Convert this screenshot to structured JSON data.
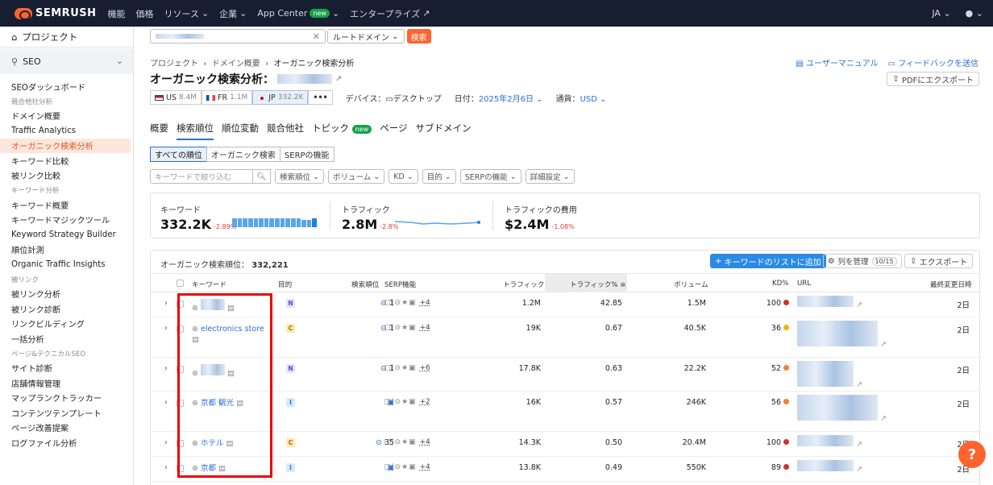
{
  "topbar": {
    "brand": "SEMRUSH",
    "nav": [
      "機能",
      "価格",
      "リソース",
      "企業",
      "App Center",
      "エンタープライズ"
    ],
    "app_center_badge": "new",
    "lang": "JA"
  },
  "sidebar": {
    "project": "プロジェクト",
    "seo": "SEO",
    "items": [
      {
        "type": "item",
        "label": "SEOダッシュボード"
      },
      {
        "type": "cat",
        "label": "競合他社分析"
      },
      {
        "type": "item",
        "label": "ドメイン概要"
      },
      {
        "type": "item",
        "label": "Traffic Analytics"
      },
      {
        "type": "active",
        "label": "オーガニック検索分析"
      },
      {
        "type": "item",
        "label": "キーワード比較"
      },
      {
        "type": "item",
        "label": "被リンク比較"
      },
      {
        "type": "cat",
        "label": "キーワード分析"
      },
      {
        "type": "item",
        "label": "キーワード概要"
      },
      {
        "type": "item",
        "label": "キーワードマジックツール"
      },
      {
        "type": "item",
        "label": "Keyword Strategy Builder"
      },
      {
        "type": "item",
        "label": "順位計測"
      },
      {
        "type": "item",
        "label": "Organic Traffic Insights"
      },
      {
        "type": "cat",
        "label": "被リンク"
      },
      {
        "type": "item",
        "label": "被リンク分析"
      },
      {
        "type": "item",
        "label": "被リンク診断"
      },
      {
        "type": "item",
        "label": "リンクビルディング"
      },
      {
        "type": "item",
        "label": "一括分析"
      },
      {
        "type": "cat",
        "label": "ページ&テクニカルSEO"
      },
      {
        "type": "item",
        "label": "サイト診断"
      },
      {
        "type": "item",
        "label": "店舗情報管理"
      },
      {
        "type": "item",
        "label": "マップランクトラッカー"
      },
      {
        "type": "item",
        "label": "コンテンツテンプレート"
      },
      {
        "type": "item",
        "label": "ページ改善提案"
      },
      {
        "type": "item",
        "label": "ログファイル分析"
      }
    ]
  },
  "search": {
    "placeholder": "",
    "scope": "ルートドメイン",
    "button": "検索"
  },
  "breadcrumb": [
    "プロジェクト",
    "ドメイン概要",
    "オーガニック検索分析"
  ],
  "links": {
    "manual": "ユーザーマニュアル",
    "feedback": "フィードバックを送信",
    "pdf": "PDFにエクスポート"
  },
  "page_title": "オーガニック検索分析：",
  "databases": [
    {
      "flag": "US",
      "label": "US",
      "count": "8.4M"
    },
    {
      "flag": "FR",
      "label": "FR",
      "count": "1.1M"
    },
    {
      "flag": "JP",
      "label": "JP",
      "count": "332.2K"
    }
  ],
  "meta": {
    "device_label": "デバイス：",
    "device": "デスクトップ",
    "date_label": "日付：",
    "date": "2025年2月6日",
    "currency_label": "通貨：",
    "currency": "USD"
  },
  "tabs": [
    "概要",
    "検索順位",
    "順位変動",
    "競合他社",
    "トピック",
    "ページ",
    "サブドメイン"
  ],
  "tab_new_badge": "new",
  "segments": [
    "すべての順位",
    "オーガニック検索",
    "SERPの機能"
  ],
  "filters": {
    "placeholder": "キーワードで絞り込む",
    "dropdowns": [
      "検索順位",
      "ボリューム",
      "KD",
      "目的",
      "SERPの機能",
      "詳細設定"
    ]
  },
  "stats": {
    "keywords": {
      "label": "キーワード",
      "value": "332.2K",
      "delta": "-2.89%"
    },
    "traffic": {
      "label": "トラフィック",
      "value": "2.8M",
      "delta": "-2.8%"
    },
    "cost": {
      "label": "トラフィックの費用",
      "value": "$2.4M",
      "delta": "-1.08%"
    }
  },
  "table": {
    "title": "オーガニック検索順位：",
    "count": "332,221",
    "add_button": "キーワードのリストに追加",
    "columns_button": "列を管理",
    "columns_count": "10/15",
    "export_button": "エクスポート",
    "headers": [
      "キーワード",
      "目的",
      "検索順位",
      "SERP機能",
      "トラフィック",
      "トラフィック%",
      "ボリューム",
      "KD%",
      "URL",
      "最終変更日時"
    ],
    "rows": [
      {
        "keyword": "",
        "intent": "N",
        "pos": "1",
        "serp_more": "+4",
        "traffic": "1.2M",
        "tpct": "42.85",
        "volume": "1.5M",
        "kd": "100",
        "kd_color": "#d32f2f",
        "updated": "2日",
        "h": 31
      },
      {
        "keyword": "electronics store",
        "intent": "C",
        "pos": "1",
        "serp_more": "+4",
        "traffic": "19K",
        "tpct": "0.67",
        "volume": "40.5K",
        "kd": "36",
        "kd_color": "#f5b400",
        "updated": "2日",
        "h": 50
      },
      {
        "keyword": "",
        "intent": "N",
        "pos": "1",
        "serp_more": "+6",
        "traffic": "17.8K",
        "tpct": "0.63",
        "volume": "22.2K",
        "kd": "52",
        "kd_color": "#ff7a33",
        "updated": "2日",
        "h": 42
      },
      {
        "keyword": "京都 観光",
        "intent": "I",
        "pos": "",
        "serp_more": "+2",
        "traffic": "16K",
        "tpct": "0.57",
        "volume": "246K",
        "kd": "56",
        "kd_color": "#ff7a33",
        "updated": "2日",
        "h": 50
      },
      {
        "keyword": "ホテル",
        "intent": "C",
        "pos": "35",
        "serp_more": "+4",
        "traffic": "14.3K",
        "tpct": "0.50",
        "volume": "20.4M",
        "kd": "100",
        "kd_color": "#d32f2f",
        "updated": "2日",
        "h": 31
      },
      {
        "keyword": "京都",
        "intent": "I",
        "pos": "",
        "serp_more": "+4",
        "traffic": "13.8K",
        "tpct": "0.49",
        "volume": "550K",
        "kd": "89",
        "kd_color": "#d32f2f",
        "updated": "2日",
        "h": 31
      }
    ]
  }
}
